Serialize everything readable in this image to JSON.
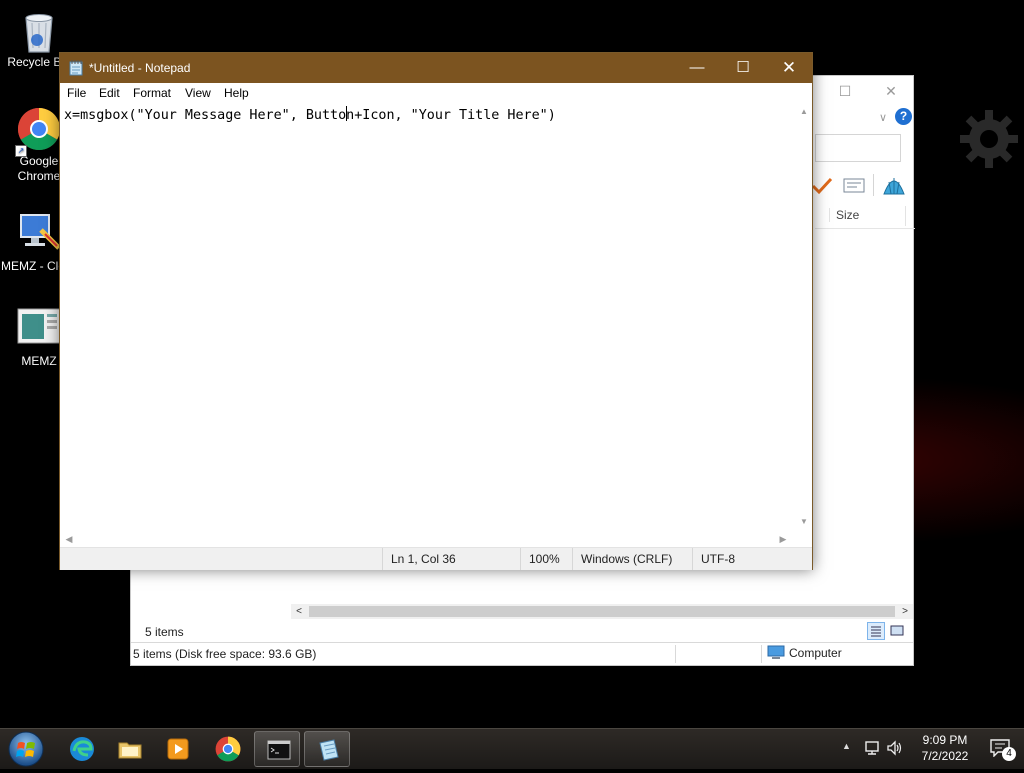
{
  "desktop": {
    "icons": [
      {
        "label": "Recycle Bin"
      },
      {
        "label": "Google Chrome"
      },
      {
        "label": "MEMZ - Clean"
      },
      {
        "label": "MEMZ"
      }
    ]
  },
  "explorer": {
    "column_size": "Size",
    "items_count": "5 items",
    "status_left": "5 items (Disk free space: 93.6 GB)",
    "status_location": "Computer"
  },
  "notepad": {
    "title": "*Untitled - Notepad",
    "menu": [
      "File",
      "Edit",
      "Format",
      "View",
      "Help"
    ],
    "text_before_caret": "x=msgbox(\"Your Message Here\", Butto",
    "text_after_caret": "n+Icon, \"Your Title Here\")",
    "status": {
      "position": "Ln 1, Col 36",
      "zoom": "100%",
      "line_ending": "Windows (CRLF)",
      "encoding": "UTF-8"
    }
  },
  "taskbar": {
    "time": "9:09 PM",
    "date": "7/2/2022",
    "notification_count": "4"
  },
  "colors": {
    "notepad_titlebar": "#7c5420",
    "taskbar": "#24211e"
  }
}
